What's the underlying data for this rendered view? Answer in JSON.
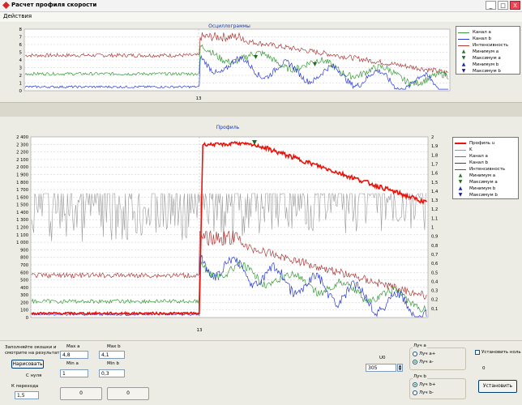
{
  "window": {
    "title": "Расчет профиля скорости",
    "minimize": "_",
    "maximize": "□",
    "close": "X"
  },
  "menu": {
    "actions": "Действия"
  },
  "colors": {
    "channel_a": "#3a9a3a",
    "channel_b": "#2a3ad0",
    "intensity": "#b03a3a",
    "profile": "#e8140c",
    "k": "#9a9a9a",
    "min_a": "#2c7a2c",
    "max_a": "#1f6a1f",
    "min_b": "#1f2aa0",
    "max_b": "#1a1a80"
  },
  "osc": {
    "title": "Осциллограммы",
    "x_marker": "13",
    "y_ticks": [
      "8",
      "7",
      "6",
      "5",
      "4",
      "3",
      "2",
      "1",
      "0"
    ],
    "legend": [
      {
        "label": "Канал a",
        "kind": "line",
        "color": "#3a9a3a"
      },
      {
        "label": "Канал b",
        "kind": "line",
        "color": "#2a3ad0"
      },
      {
        "label": "Интенсивность",
        "kind": "line",
        "color": "#b03a3a"
      },
      {
        "label": "Минимум a",
        "kind": "up",
        "color": "#2c7a2c"
      },
      {
        "label": "Максимум a",
        "kind": "down",
        "color": "#1f6a1f"
      },
      {
        "label": "Минимум b",
        "kind": "up",
        "color": "#1f2aa0"
      },
      {
        "label": "Максимум b",
        "kind": "down",
        "color": "#1a1a80"
      }
    ]
  },
  "profile": {
    "title": "Профиль",
    "x_marker": "13",
    "y_left_ticks": [
      "2 400",
      "2 300",
      "2 200",
      "2 100",
      "2 000",
      "1 900",
      "1 800",
      "1 700",
      "1 600",
      "1 500",
      "1 400",
      "1 300",
      "1 200",
      "1 100",
      "1 000",
      "900",
      "800",
      "700",
      "600",
      "500",
      "400",
      "300",
      "200",
      "100",
      "0"
    ],
    "y_right_ticks": [
      "2",
      "1,9",
      "1,8",
      "1,7",
      "1,6",
      "1,5",
      "1,4",
      "1,3",
      "1,2",
      "1,1",
      "1",
      "0,9",
      "0,8",
      "0,7",
      "0,6",
      "0,5",
      "0,4",
      "0,3",
      "0,2",
      "0,1"
    ],
    "legend": [
      {
        "label": "Профиль u",
        "kind": "thick",
        "color": "#e8140c"
      },
      {
        "label": "K",
        "kind": "line",
        "color": "#9a9a9a"
      },
      {
        "label": "Канал a",
        "kind": "line",
        "color": "#3a9a3a"
      },
      {
        "label": "Канал b",
        "kind": "line",
        "color": "#2a3ad0"
      },
      {
        "label": "Интенсивность",
        "kind": "line",
        "color": "#b03a3a"
      },
      {
        "label": "Минимум a",
        "kind": "up",
        "color": "#2c7a2c"
      },
      {
        "label": "Максимум a",
        "kind": "down",
        "color": "#1f6a1f"
      },
      {
        "label": "Минимум b",
        "kind": "up",
        "color": "#1f2aa0"
      },
      {
        "label": "Максимум b",
        "kind": "down",
        "color": "#1a1a80"
      }
    ]
  },
  "controls": {
    "hint_line1": "Заполняйте окошки и",
    "hint_line2": "смотрите на результат",
    "draw_button": "Нарисовать",
    "from_zero": "С нуля",
    "k_transition_label": "К перехода",
    "k_transition_value": "1,5",
    "max_a_label": "Max a",
    "max_a_value": "4,8",
    "max_b_label": "Max b",
    "max_b_value": "4,1",
    "min_a_label": "Min a",
    "min_a_value": "1",
    "min_b_label": "Min b",
    "min_b_value": "0,3",
    "counter_a": "0",
    "counter_b": "0",
    "u0_label": "U0",
    "u0_value": "305",
    "beam_a_title": "Луч a",
    "beam_a_plus": "Луч a+",
    "beam_a_minus": "Луч a-",
    "beam_b_title": "Луч b",
    "beam_b_plus": "Луч b+",
    "beam_b_minus": "Луч b-",
    "set_zero_label": "Установить ноль",
    "zero_value": "0",
    "set_button": "Установить"
  }
}
